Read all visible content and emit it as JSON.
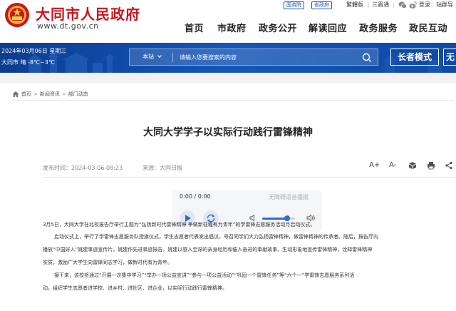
{
  "header": {
    "site_name": "大同市人民政府",
    "site_url": "www.dt.gov.cn",
    "top_links": [
      "国务院",
      "省政府"
    ],
    "utils": [
      "繁體版",
      "三晋通",
      "登录",
      "站群导"
    ],
    "social_icons": [
      "wechat-icon",
      "weibo-icon"
    ],
    "nav": [
      "首页",
      "市政府",
      "政务公开",
      "解读回应",
      "政务服务",
      "政民互动"
    ],
    "brand_color": "#c8161d"
  },
  "banner": {
    "date": "2024年03月06日 星期三",
    "weather": "大同市 晴 -8℃~3℃",
    "search_scope": "本站",
    "search_placeholder": "请输入您要搜索的内容",
    "elder_mode": "长者模式",
    "elder_mode_partial": "无",
    "accent_color": "#1456b8"
  },
  "breadcrumb": [
    "首页",
    "新闻资讯",
    "部门动态"
  ],
  "article": {
    "title": "大同大学学子以实际行动践行雷锋精神",
    "publish_label": "发布时间：2024-03-06 08:23",
    "source_label": "来源：大同日报",
    "font_increase": "A+",
    "font_decrease": "A-",
    "tool_icons": [
      "font-increase-icon",
      "font-decrease-icon",
      "share-icon",
      "print-icon",
      "more-icon"
    ],
    "paragraphs": [
      "3月5日，大同大学在北校报告厅举行主题为“弘扬新时代雷锋精神 争做新征程有为青年”的学雷锋志愿服务活动月启动仪式。",
      "启动仪式上，举行了学雷锋志愿服务队授旗仪式，学生志愿者代表发出倡议，号召同学们大力弘扬雷锋精神，做雷锋精神的传承者。随后，报告厅内",
      "播放“中国好人”姚建事迹宣传片，姚建作先进事迹报告。姚建以感人至深的亲身经历和催人奋进的奉献故事，生动形象地宣传雷锋精神，诠释雷锋精神",
      "实质，激励广大学生向雷锋同志学习，做新时代有为青年。",
      "接下来，该校将通过“开展一次集中学习”“举办一场公益宣讲”“参与一项公益活动”“巩固一个雷锋任务”等“六个一”学雷锋志愿服务系列活",
      "动，组织学生志愿者进学校、进乡村、进社区、进企业，以实际行动践行雷锋精神。"
    ]
  },
  "player": {
    "time": "0:00 / 0:00",
    "label": "无障碍语音播报",
    "volume": 0.75,
    "accent_color": "#2f6bd6"
  }
}
